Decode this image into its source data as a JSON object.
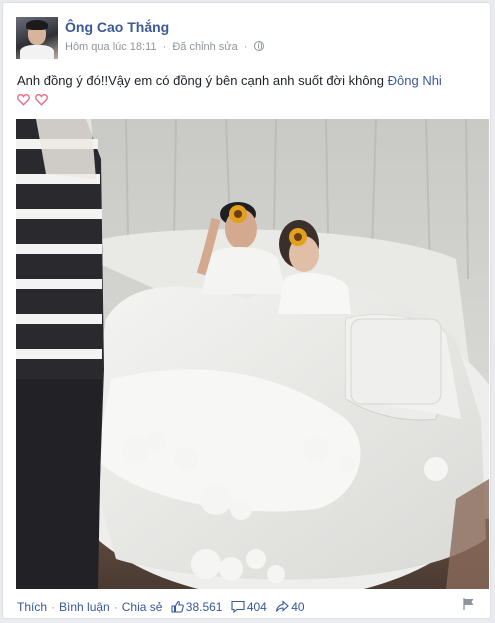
{
  "post": {
    "author": "Ông Cao Thắng",
    "timestamp": "Hôm qua lúc 18:11",
    "meta_separator": "·",
    "edited_label": "Đã chỉnh sửa",
    "privacy_icon": "globe-icon",
    "text_before_link": "Anh đồng ý đó!!Vậy em có đồng ý bên cạnh anh suốt đời không ",
    "tagged_name": "Đông Nhi",
    "heart_color": "#e86f82",
    "heart_count": 2
  },
  "photo": {
    "description_icon": "photo"
  },
  "footer": {
    "like_label": "Thích",
    "comment_label": "Bình luận",
    "share_label": "Chia sẻ",
    "separator": "·",
    "likes_count": "38.561",
    "comments_count": "404",
    "shares_count": "40"
  },
  "colors": {
    "link": "#3b5998",
    "meta": "#90949c",
    "background": "#e9ebee"
  }
}
